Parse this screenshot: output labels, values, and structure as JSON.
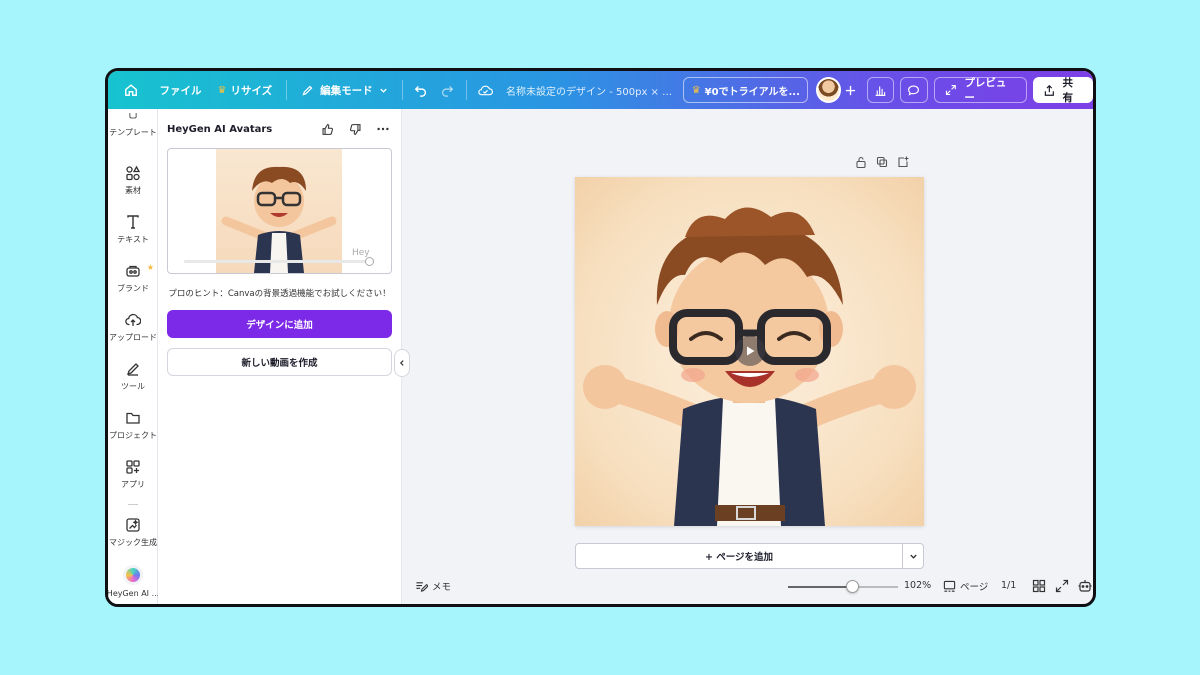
{
  "topbar": {
    "file": "ファイル",
    "resize": "リサイズ",
    "edit_mode": "編集モード",
    "doc_title": "名称未設定のデザイン - 500px × 50...",
    "trial": "¥0でトライアルを...",
    "preview": "プレビュー",
    "share": "共有"
  },
  "rail": {
    "items": [
      {
        "label": "テンプレート",
        "icon": "template-icon"
      },
      {
        "label": "素材",
        "icon": "elements-icon"
      },
      {
        "label": "テキスト",
        "icon": "text-icon"
      },
      {
        "label": "ブランド",
        "icon": "brand-icon"
      },
      {
        "label": "アップロード",
        "icon": "upload-icon"
      },
      {
        "label": "ツール",
        "icon": "tool-icon"
      },
      {
        "label": "プロジェクト",
        "icon": "folder-icon"
      },
      {
        "label": "アプリ",
        "icon": "apps-icon"
      },
      {
        "label": "マジック生成",
        "icon": "magic-icon"
      },
      {
        "label": "HeyGen AI ...",
        "icon": "heygen-logo"
      }
    ]
  },
  "panel": {
    "title": "HeyGen AI Avatars",
    "watermark": "Hey",
    "hint": "プロのヒント：Canvaの背景透過機能でお試しください！",
    "add_to_design": "デザインに追加",
    "create_video": "新しい動画を作成"
  },
  "canvas": {
    "add_page": "+ ページを追加"
  },
  "bottombar": {
    "memo": "メモ",
    "zoom": "102%",
    "zoom_fraction": 0.58,
    "pages": "ページ",
    "page_count": "1/1"
  },
  "colors": {
    "accent": "#7d2ae8",
    "page_bg": "#a6f5fd"
  }
}
